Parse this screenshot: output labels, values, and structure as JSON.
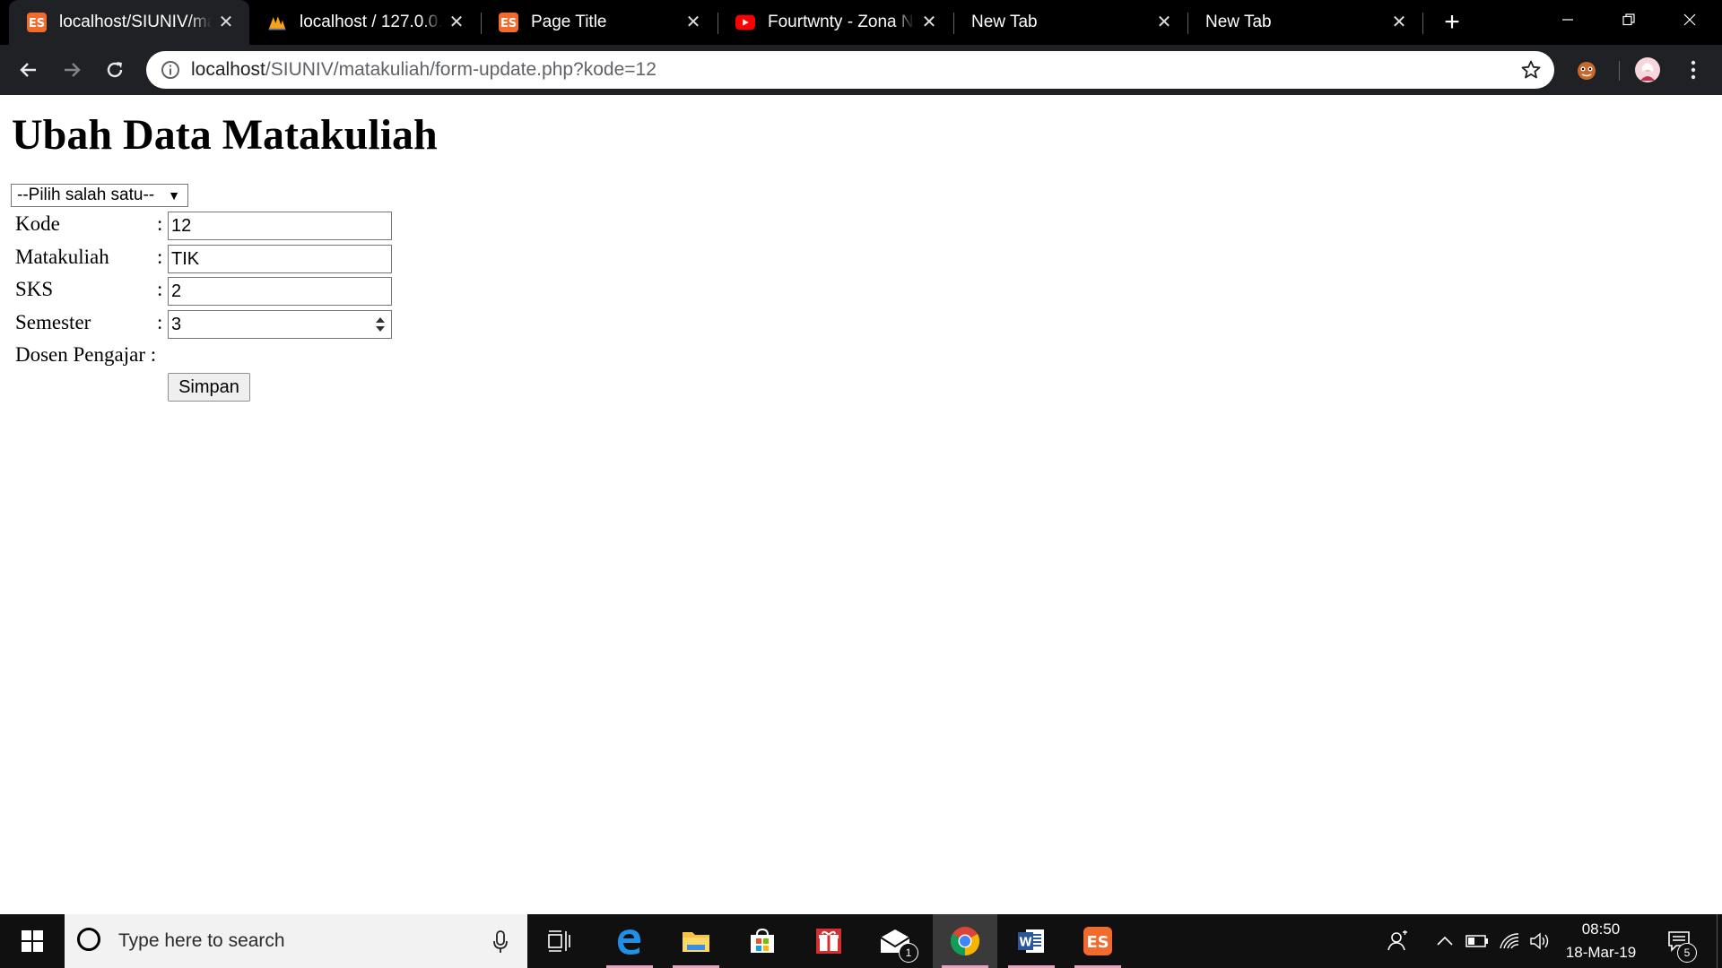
{
  "browser": {
    "tabs": [
      {
        "title": "localhost/SIUNIV/ma",
        "favicon": "xampp-icon",
        "active": true
      },
      {
        "title": "localhost / 127.0.0.1",
        "favicon": "phpmyadmin-icon",
        "active": false
      },
      {
        "title": "Page Title",
        "favicon": "xampp-icon",
        "active": false
      },
      {
        "title": "Fourtwnty - Zona Ny",
        "favicon": "youtube-icon",
        "active": false
      },
      {
        "title": "New Tab",
        "favicon": "",
        "active": false
      },
      {
        "title": "New Tab",
        "favicon": "",
        "active": false
      }
    ],
    "address": {
      "host": "localhost",
      "path": "/SIUNIV/matakuliah/form-update.php?kode=12"
    },
    "colors": {
      "tabstrip": "#000000",
      "toolbar": "#202124",
      "accent_orange": "#f26a2e",
      "youtube_red": "#ff0000"
    }
  },
  "page": {
    "title": "Ubah Data Matakuliah",
    "select": {
      "selected": "--Pilih salah satu--"
    },
    "form": {
      "kode": {
        "label": "Kode",
        "value": "12"
      },
      "matakuliah": {
        "label": "Matakuliah",
        "value": "TIK"
      },
      "sks": {
        "label": "SKS",
        "value": "2"
      },
      "semester": {
        "label": "Semester",
        "value": "3"
      },
      "dosen": {
        "label": "Dosen Pengajar"
      },
      "colon": ":",
      "submit_label": "Simpan"
    }
  },
  "taskbar": {
    "search_placeholder": "Type here to search",
    "time": "08:50",
    "date": "18-Mar-19",
    "mail_badge": "1",
    "notification_badge": "5",
    "apps": [
      "task-view-icon",
      "edge-icon",
      "file-explorer-icon",
      "store-icon",
      "gift-icon",
      "mail-icon",
      "chrome-icon",
      "word-icon",
      "xampp-icon"
    ]
  }
}
